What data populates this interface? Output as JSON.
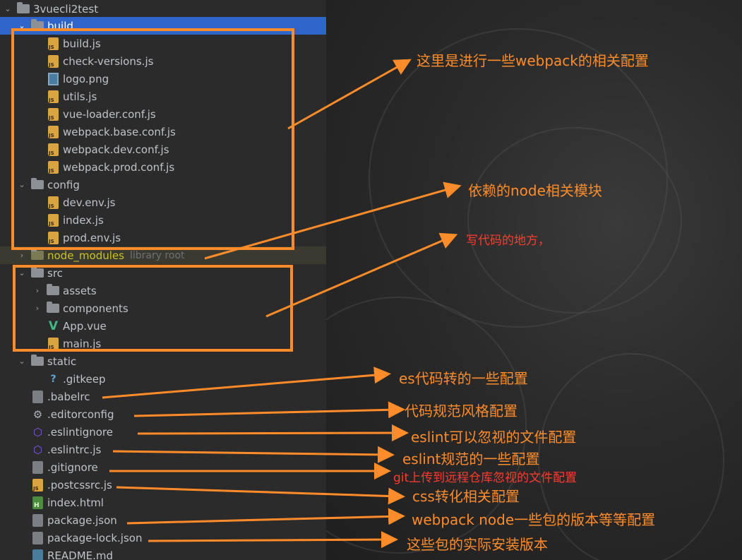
{
  "tree": {
    "root": {
      "label": "3vuecli2test"
    },
    "rows": [
      {
        "label": "build"
      },
      {
        "label": "build.js"
      },
      {
        "label": "check-versions.js"
      },
      {
        "label": "logo.png"
      },
      {
        "label": "utils.js"
      },
      {
        "label": "vue-loader.conf.js"
      },
      {
        "label": "webpack.base.conf.js"
      },
      {
        "label": "webpack.dev.conf.js"
      },
      {
        "label": "webpack.prod.conf.js"
      },
      {
        "label": "config"
      },
      {
        "label": "dev.env.js"
      },
      {
        "label": "index.js"
      },
      {
        "label": "prod.env.js"
      },
      {
        "label": "node_modules",
        "note": "library root"
      },
      {
        "label": "src"
      },
      {
        "label": "assets"
      },
      {
        "label": "components"
      },
      {
        "label": "App.vue"
      },
      {
        "label": "main.js"
      },
      {
        "label": "static"
      },
      {
        "label": ".gitkeep"
      },
      {
        "label": ".babelrc"
      },
      {
        "label": ".editorconfig"
      },
      {
        "label": ".eslintignore"
      },
      {
        "label": ".eslintrc.js"
      },
      {
        "label": ".gitignore"
      },
      {
        "label": ".postcssrc.js"
      },
      {
        "label": "index.html"
      },
      {
        "label": "package.json"
      },
      {
        "label": "package-lock.json"
      },
      {
        "label": "README.md"
      }
    ]
  },
  "annotations": {
    "build": "这里是进行一些webpack的相关配置",
    "node_modules": "依赖的node相关模块",
    "src": "写代码的地方，",
    "babelrc": "es代码转的一些配置",
    "editorconfig": "代码规范风格配置",
    "eslintignore": "eslint可以忽视的文件配置",
    "eslintrc": "eslint规范的一些配置",
    "gitignore": "git上传到远程仓库忽视的文件配置",
    "postcssrc": "css转化相关配置",
    "package_json": "webpack node一些包的版本等等配置",
    "package_lock": "这些包的实际安装版本"
  },
  "colors": {
    "annotation": "#ff8c2b",
    "annotation_red": "#ff3b2f",
    "selection": "#2f65ca",
    "node_modules": "#c9c227"
  }
}
